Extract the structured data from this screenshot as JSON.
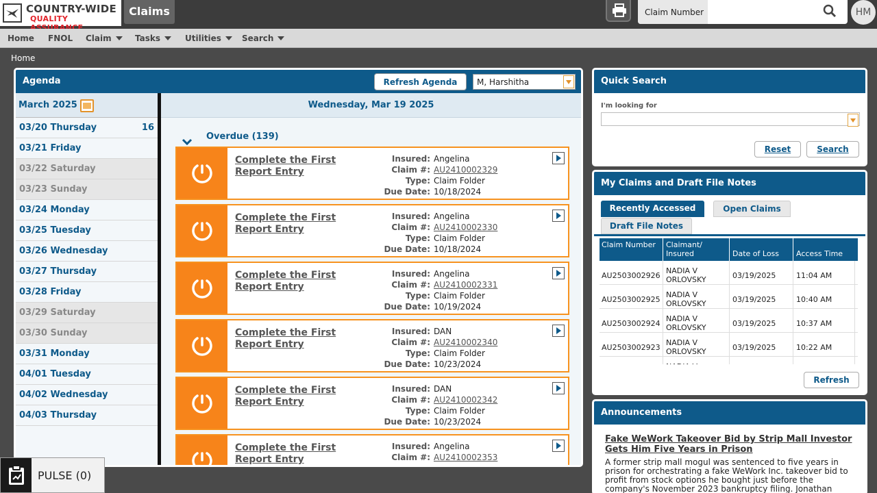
{
  "brand": {
    "name_line1": "COUNTRY-WIDE",
    "name_line2": "QUALITY ASSURANCE",
    "accent_color": "#e2232a"
  },
  "app_tab": "Claims",
  "header_search": {
    "label": "Claim Number",
    "value": "",
    "icon": "search-icon"
  },
  "user_initials": "HM",
  "nav": {
    "items": [
      "Home",
      "FNOL",
      "Claim",
      "Tasks",
      "Utilities",
      "Search"
    ]
  },
  "breadcrumb": "Home",
  "agenda": {
    "title": "Agenda",
    "refresh_label": "Refresh Agenda",
    "user_select": "M, Harshitha",
    "month": "March 2025",
    "selected_date": "Wednesday, Mar 19 2025",
    "days": [
      {
        "label": "03/20 Thursday",
        "count": "16",
        "weekend": false
      },
      {
        "label": "03/21 Friday",
        "count": "",
        "weekend": false
      },
      {
        "label": "03/22 Saturday",
        "count": "",
        "weekend": true
      },
      {
        "label": "03/23 Sunday",
        "count": "",
        "weekend": true
      },
      {
        "label": "03/24 Monday",
        "count": "",
        "weekend": false
      },
      {
        "label": "03/25 Tuesday",
        "count": "",
        "weekend": false
      },
      {
        "label": "03/26 Wednesday",
        "count": "",
        "weekend": false
      },
      {
        "label": "03/27 Thursday",
        "count": "",
        "weekend": false
      },
      {
        "label": "03/28 Friday",
        "count": "",
        "weekend": false
      },
      {
        "label": "03/29 Saturday",
        "count": "",
        "weekend": true
      },
      {
        "label": "03/30 Sunday",
        "count": "",
        "weekend": true
      },
      {
        "label": "03/31 Monday",
        "count": "",
        "weekend": false
      },
      {
        "label": "04/01 Tuesday",
        "count": "",
        "weekend": false
      },
      {
        "label": "04/02 Wednesday",
        "count": "",
        "weekend": false
      },
      {
        "label": "04/03 Thursday",
        "count": "",
        "weekend": false
      }
    ],
    "overdue_label": "Overdue (139)",
    "field_labels": {
      "insured": "Insured:",
      "claim": "Claim #:",
      "type": "Type:",
      "due": "Due Date:"
    },
    "tasks": [
      {
        "title": "Complete the First Report Entry",
        "insured": "Angelina",
        "claim": "AU2410002329",
        "type": "Claim Folder",
        "due": "10/18/2024"
      },
      {
        "title": "Complete the First Report Entry",
        "insured": "Angelina",
        "claim": "AU2410002330",
        "type": "Claim Folder",
        "due": "10/18/2024"
      },
      {
        "title": "Complete the First Report Entry",
        "insured": "Angelina",
        "claim": "AU2410002331",
        "type": "Claim Folder",
        "due": "10/19/2024"
      },
      {
        "title": "Complete the First Report Entry",
        "insured": "DAN",
        "claim": "AU2410002340",
        "type": "Claim Folder",
        "due": "10/23/2024"
      },
      {
        "title": "Complete the First Report Entry",
        "insured": "DAN",
        "claim": "AU2410002342",
        "type": "Claim Folder",
        "due": "10/23/2024"
      },
      {
        "title": "Complete the First Report Entry",
        "insured": "Angelina",
        "claim": "AU2410002353",
        "type": "",
        "due": ""
      }
    ]
  },
  "quick_search": {
    "title": "Quick Search",
    "label": "I'm looking for",
    "value": "",
    "reset_label": "Reset",
    "search_label": "Search"
  },
  "my_claims": {
    "title": "My Claims and Draft File Notes",
    "tabs": [
      "Recently Accessed",
      "Open Claims",
      "Draft File Notes"
    ],
    "columns": [
      "Claim Number",
      "Claimant/ Insured",
      "Date of Loss",
      "Access Time"
    ],
    "rows": [
      {
        "claim": "AU2503002926",
        "claimant": "NADIA V ORLOVSKY",
        "date": "03/19/2025",
        "time": "11:04 AM"
      },
      {
        "claim": "AU2503002925",
        "claimant": "NADIA V ORLOVSKY",
        "date": "03/19/2025",
        "time": "10:40 AM"
      },
      {
        "claim": "AU2503002924",
        "claimant": "NADIA V ORLOVSKY",
        "date": "03/19/2025",
        "time": "10:37 AM"
      },
      {
        "claim": "AU2503002923",
        "claimant": "NADIA V ORLOVSKY",
        "date": "03/19/2025",
        "time": "10:22 AM"
      },
      {
        "claim": "",
        "claimant": "NADIA V",
        "date": "",
        "time": ""
      }
    ],
    "refresh_label": "Refresh"
  },
  "announcements": {
    "title": "Announcements",
    "headline": "Fake WeWork Takeover Bid by Strip Mall Investor Gets Him Five Years in Prison",
    "body": "A former strip mall mogul was sentenced to five years in prison for orchestrating a fake WeWork Inc. takeover bid to profit from stock options he bought just before the company's November 2023 bankruptcy filing. Jonathan Larmore,"
  },
  "pulse": {
    "label": "PULSE  (0)"
  }
}
